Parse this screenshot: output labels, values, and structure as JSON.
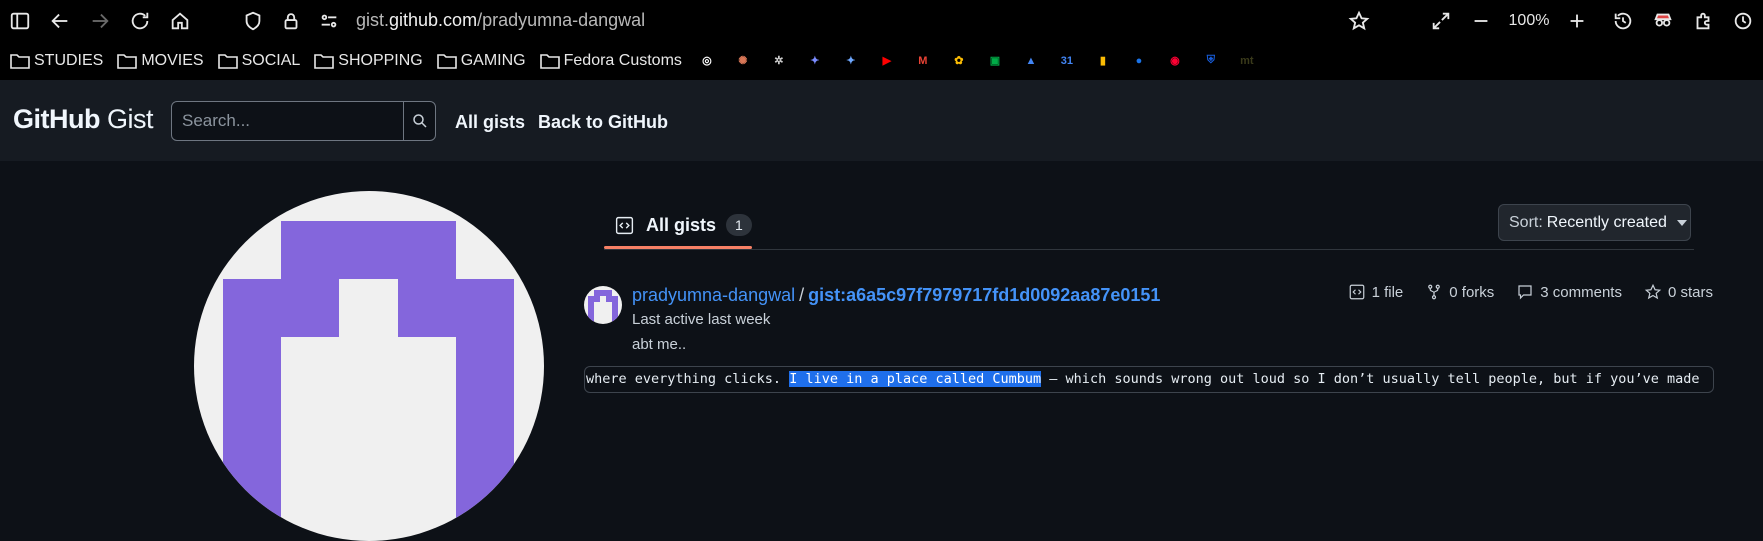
{
  "browser": {
    "url_prefix": "gist.",
    "url_host": "github.com",
    "url_path": "/pradyumna-dangwal",
    "zoom": "100%",
    "bookmark_folders": [
      "STUDIES",
      "MOVIES",
      "SOCIAL",
      "SHOPPING",
      "GAMING",
      "Fedora Customs"
    ],
    "bookmark_icons": [
      {
        "name": "chatgpt-icon",
        "color": "#ffffff",
        "glyph": "◎"
      },
      {
        "name": "claude-icon",
        "color": "#d97757",
        "glyph": "✺"
      },
      {
        "name": "extension-bug-icon",
        "color": "#cccccc",
        "glyph": "✲"
      },
      {
        "name": "copilot-icon",
        "color": "#7b8cff",
        "glyph": "✦"
      },
      {
        "name": "gemini-icon",
        "color": "#6fa8ff",
        "glyph": "✦"
      },
      {
        "name": "youtube-icon",
        "color": "#ff0000",
        "glyph": "▶"
      },
      {
        "name": "gmail-icon",
        "color": "#ea4335",
        "glyph": "M"
      },
      {
        "name": "photos-icon",
        "color": "#fbbc04",
        "glyph": "✿"
      },
      {
        "name": "meet-icon",
        "color": "#00ac47",
        "glyph": "▣"
      },
      {
        "name": "drive-icon",
        "color": "#4285f4",
        "glyph": "▲"
      },
      {
        "name": "calendar-icon",
        "color": "#4285f4",
        "glyph": "31"
      },
      {
        "name": "keep-icon",
        "color": "#fbbc04",
        "glyph": "▮"
      },
      {
        "name": "messages-icon",
        "color": "#1a73e8",
        "glyph": "●"
      },
      {
        "name": "music-icon",
        "color": "#ff0033",
        "glyph": "◉"
      },
      {
        "name": "bitwarden-icon",
        "color": "#175ddc",
        "glyph": "⛨"
      },
      {
        "name": "mt-icon",
        "color": "#3a3a1a",
        "glyph": "mt"
      }
    ]
  },
  "header": {
    "logo_bold": "GitHub",
    "logo_light": " Gist",
    "search_placeholder": "Search...",
    "nav_all_gists": "All gists",
    "nav_back": "Back to GitHub"
  },
  "tabs": {
    "all_gists_label": "All gists",
    "all_gists_count": "1"
  },
  "sort": {
    "prefix": "Sort:",
    "value": "Recently created"
  },
  "gist": {
    "owner": "pradyumna-dangwal",
    "separator": "/",
    "id": "gist:a6a5c97f7979717fd1d0092aa87e0151",
    "last_active": "Last active last week",
    "description": "abt me..",
    "files": "1 file",
    "forks": "0 forks",
    "comments": "3 comments",
    "stars": "0 stars",
    "preview_before": "where everything clicks. ",
    "preview_selected": "I live in a place called Cumbum",
    "preview_after": " — which sounds wrong out loud so I don’t usually tell people, but if you’ve made"
  }
}
